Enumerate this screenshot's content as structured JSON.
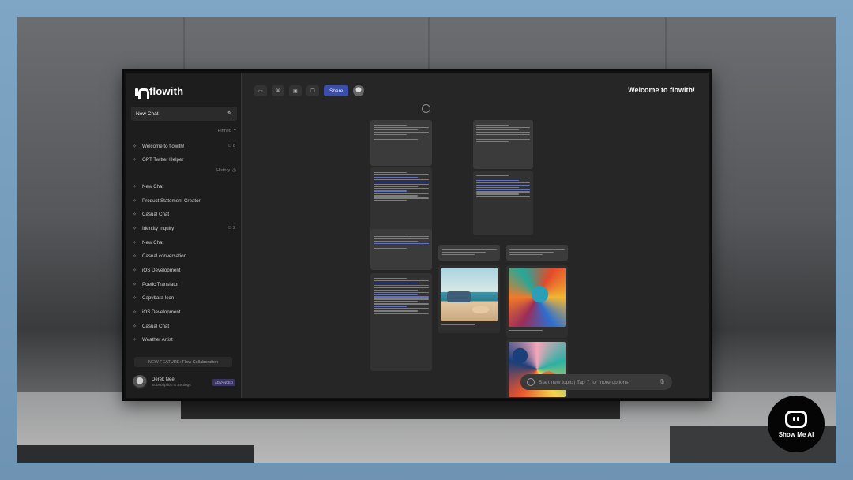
{
  "app": {
    "name": "flowith",
    "welcome_title": "Welcome to flowith!"
  },
  "sidebar": {
    "new_chat_label": "New Chat",
    "pinned_label": "Pinned",
    "history_label": "History",
    "pinned_items": [
      {
        "label": "Welcome to flowith!",
        "badge": "8"
      },
      {
        "label": "GPT Twitter Helper",
        "badge": ""
      }
    ],
    "history_items": [
      {
        "label": "New Chat",
        "badge": ""
      },
      {
        "label": "Product Statement Creator",
        "badge": ""
      },
      {
        "label": "Casual Chat",
        "badge": ""
      },
      {
        "label": "Identity Inquiry",
        "badge": "2"
      },
      {
        "label": "New Chat",
        "badge": ""
      },
      {
        "label": "Casual conversation",
        "badge": ""
      },
      {
        "label": "iOS Development",
        "badge": ""
      },
      {
        "label": "Poetic Translator",
        "badge": ""
      },
      {
        "label": "Capybara Icon",
        "badge": ""
      },
      {
        "label": "iOS Development",
        "badge": ""
      },
      {
        "label": "Casual Chat",
        "badge": ""
      },
      {
        "label": "Weather Artist",
        "badge": ""
      }
    ],
    "feature_banner": "NEW FEATURE: Flow Collaboration",
    "user": {
      "name": "Derek Nee",
      "subtitle": "Subscription & Settings",
      "plan": "ADVANCED"
    }
  },
  "toolbar": {
    "share_label": "Share"
  },
  "canvas": {
    "input_placeholder": "Start new topic | Tap '/' for more options"
  },
  "watermark": {
    "text": "Show Me AI"
  }
}
